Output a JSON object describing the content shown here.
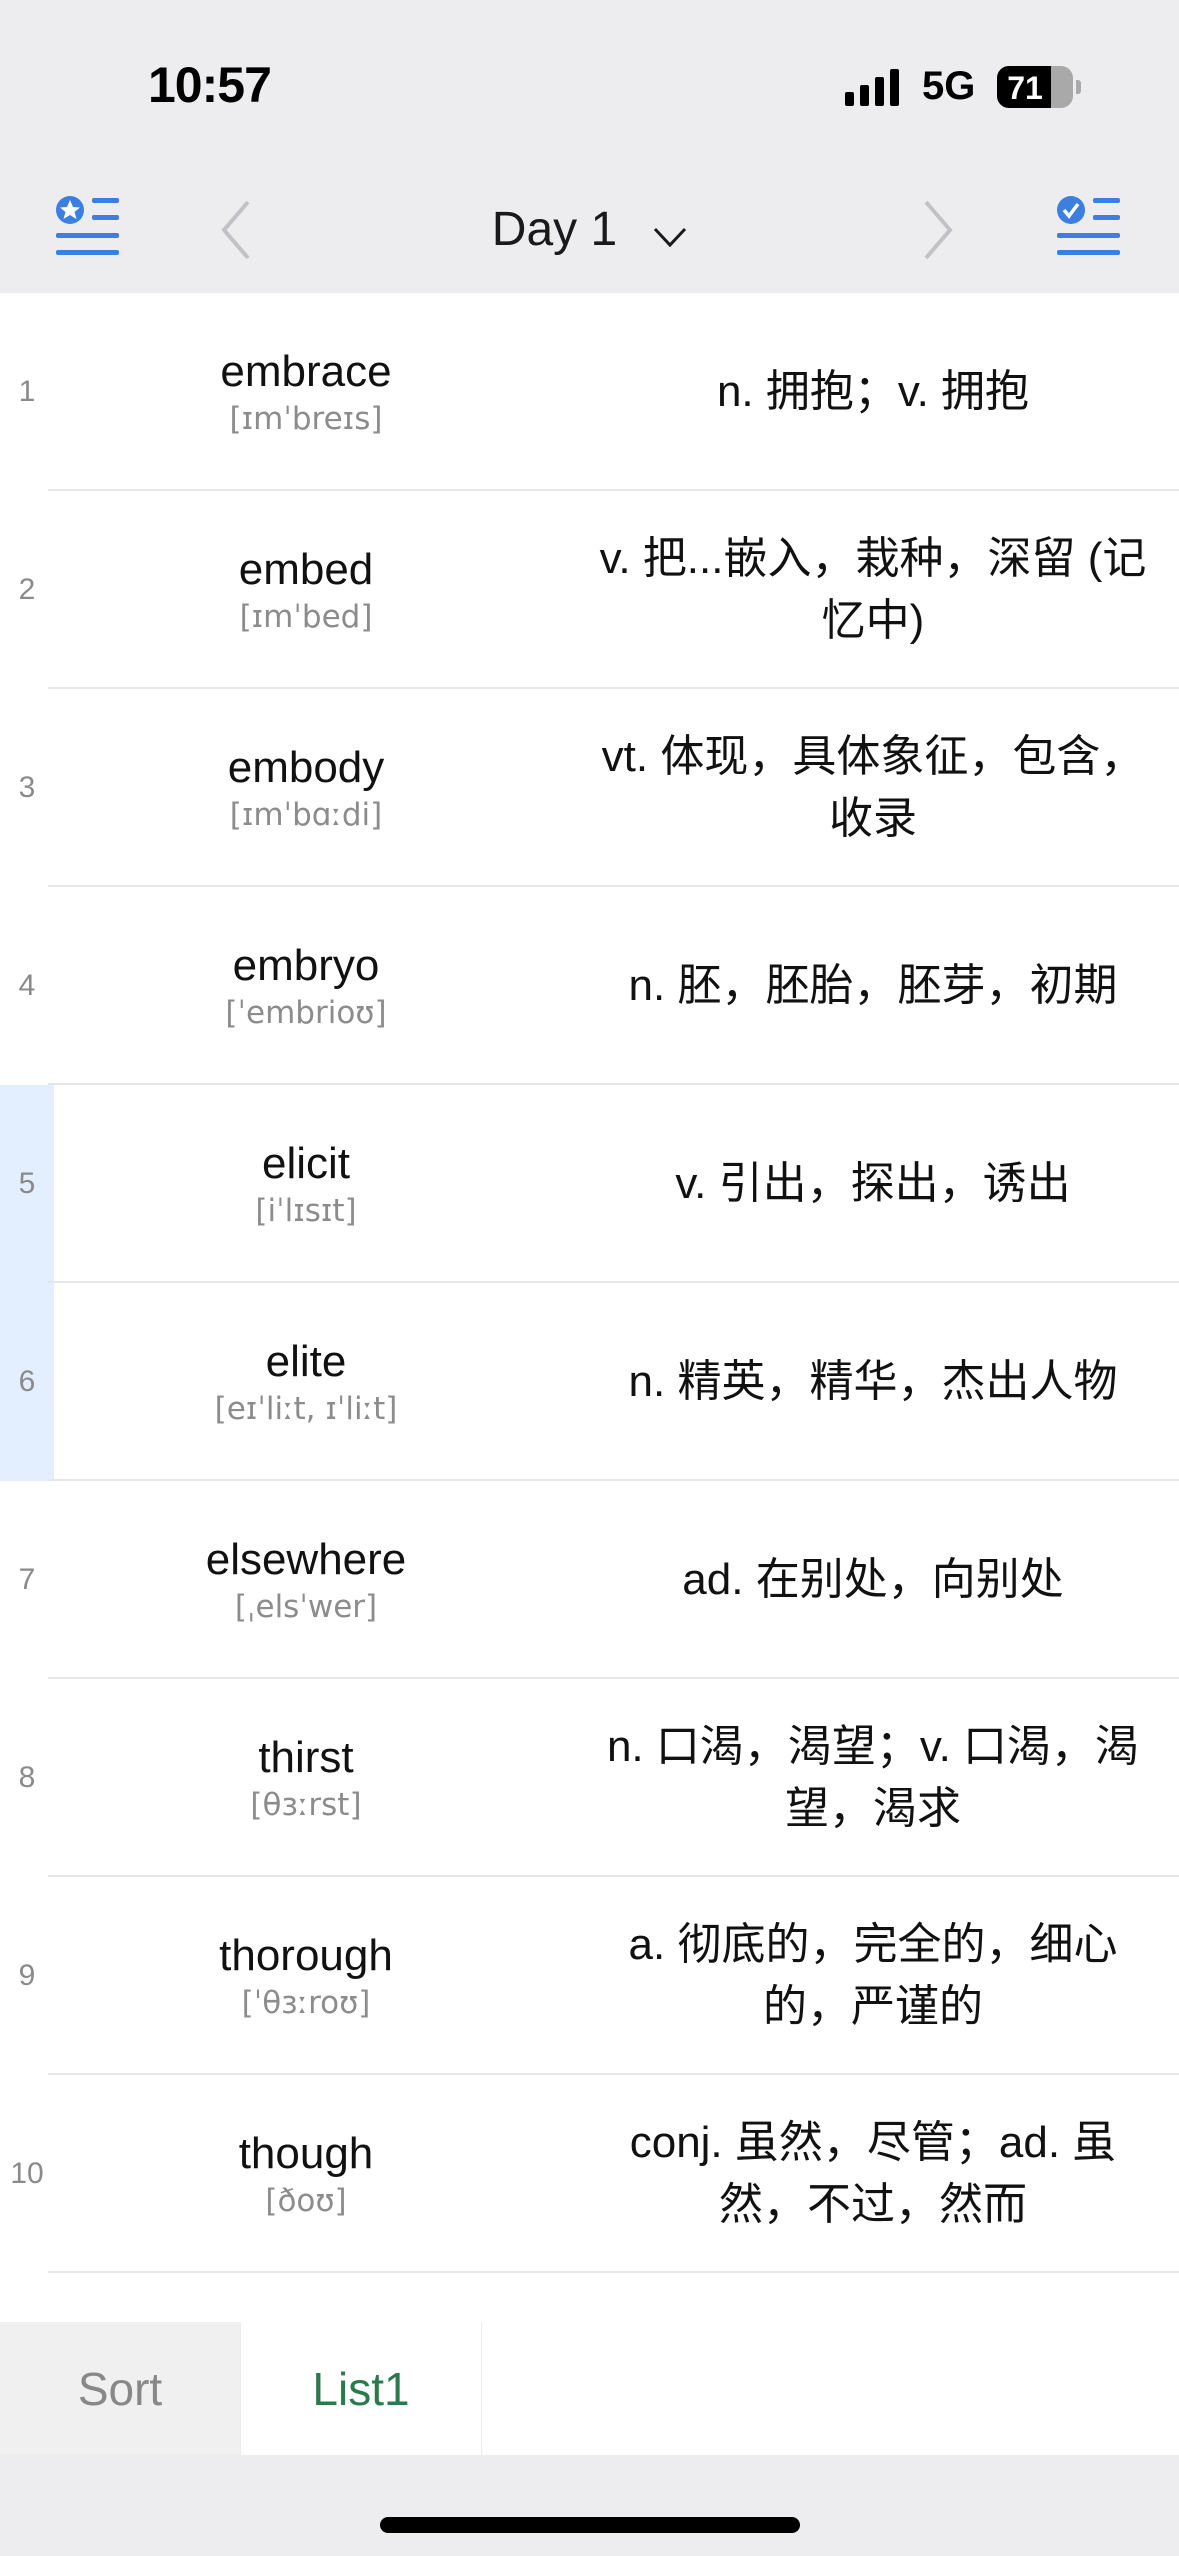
{
  "status_bar": {
    "time": "10:57",
    "network": "5G",
    "battery": "71",
    "battery_level": 0.71
  },
  "nav": {
    "title": "Day 1",
    "left_icon": "starred-list-icon",
    "right_icon": "checked-list-icon",
    "prev_icon": "chevron-left-icon",
    "next_icon": "chevron-right-icon",
    "dropdown_icon": "chevron-down-icon",
    "accent": "#3b7fe0"
  },
  "words": [
    {
      "index": "1",
      "word": "embrace",
      "phonetic": "[ɪmˈbreɪs]",
      "meaning": "n. 拥抱；v. 拥抱",
      "highlighted": false
    },
    {
      "index": "2",
      "word": "embed",
      "phonetic": "[ɪmˈbed]",
      "meaning": "v. 把...嵌入，栽种，深留 (记忆中)",
      "highlighted": false
    },
    {
      "index": "3",
      "word": "embody",
      "phonetic": "[ɪmˈbɑːdi]",
      "meaning": "vt. 体现，具体象征，包含，收录",
      "highlighted": false
    },
    {
      "index": "4",
      "word": "embryo",
      "phonetic": "[ˈembrioʊ]",
      "meaning": "n. 胚，胚胎，胚芽，初期",
      "highlighted": false
    },
    {
      "index": "5",
      "word": "elicit",
      "phonetic": "[iˈlɪsɪt]",
      "meaning": "v. 引出，探出，诱出",
      "highlighted": true
    },
    {
      "index": "6",
      "word": "elite",
      "phonetic": "[eɪˈliːt, ɪˈliːt]",
      "meaning": "n. 精英，精华，杰出人物",
      "highlighted": true
    },
    {
      "index": "7",
      "word": "elsewhere",
      "phonetic": "[ˌelsˈwer]",
      "meaning": "ad. 在别处，向别处",
      "highlighted": false
    },
    {
      "index": "8",
      "word": "thirst",
      "phonetic": "[θɜːrst]",
      "meaning": "n. 口渴，渴望；v. 口渴，渴望，渴求",
      "highlighted": false
    },
    {
      "index": "9",
      "word": "thorough",
      "phonetic": "[ˈθɜːroʊ]",
      "meaning": "a. 彻底的，完全的，细心的，严谨的",
      "highlighted": false
    },
    {
      "index": "10",
      "word": "though",
      "phonetic": "[ðoʊ]",
      "meaning": "conj. 虽然，尽管；ad. 虽然，不过，然而",
      "highlighted": false
    }
  ],
  "tabs": [
    {
      "label": "Sort",
      "active": false
    },
    {
      "label": "List1",
      "active": true
    }
  ]
}
